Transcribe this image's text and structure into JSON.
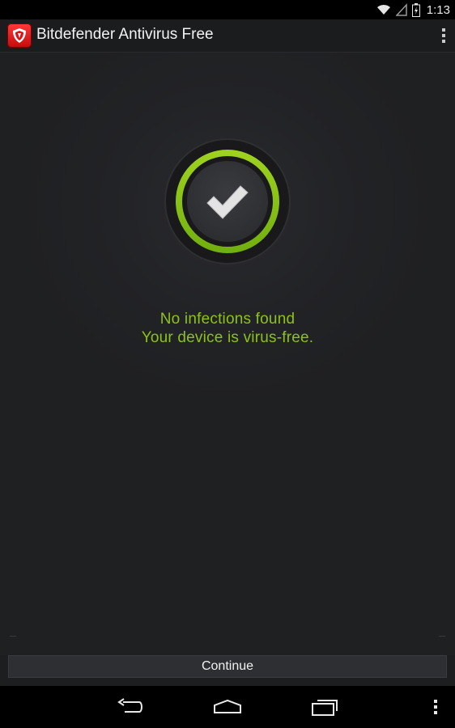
{
  "status_bar": {
    "time": "1:13",
    "icons": [
      "wifi-icon",
      "signal-icon",
      "battery-icon"
    ]
  },
  "app_bar": {
    "title": "Bitdefender Antivirus Free",
    "icon": "bitdefender-shield-icon",
    "menu_icon": "overflow-menu-icon"
  },
  "scan_result": {
    "icon": "checkmark-icon",
    "title": "No infections found",
    "subtitle": "Your device is virus-free.",
    "accent_color": "#8cc21a"
  },
  "footer": {
    "continue_label": "Continue"
  },
  "navigation": {
    "buttons": [
      "back-icon",
      "home-icon",
      "recent-apps-icon",
      "overflow-menu-icon"
    ]
  }
}
